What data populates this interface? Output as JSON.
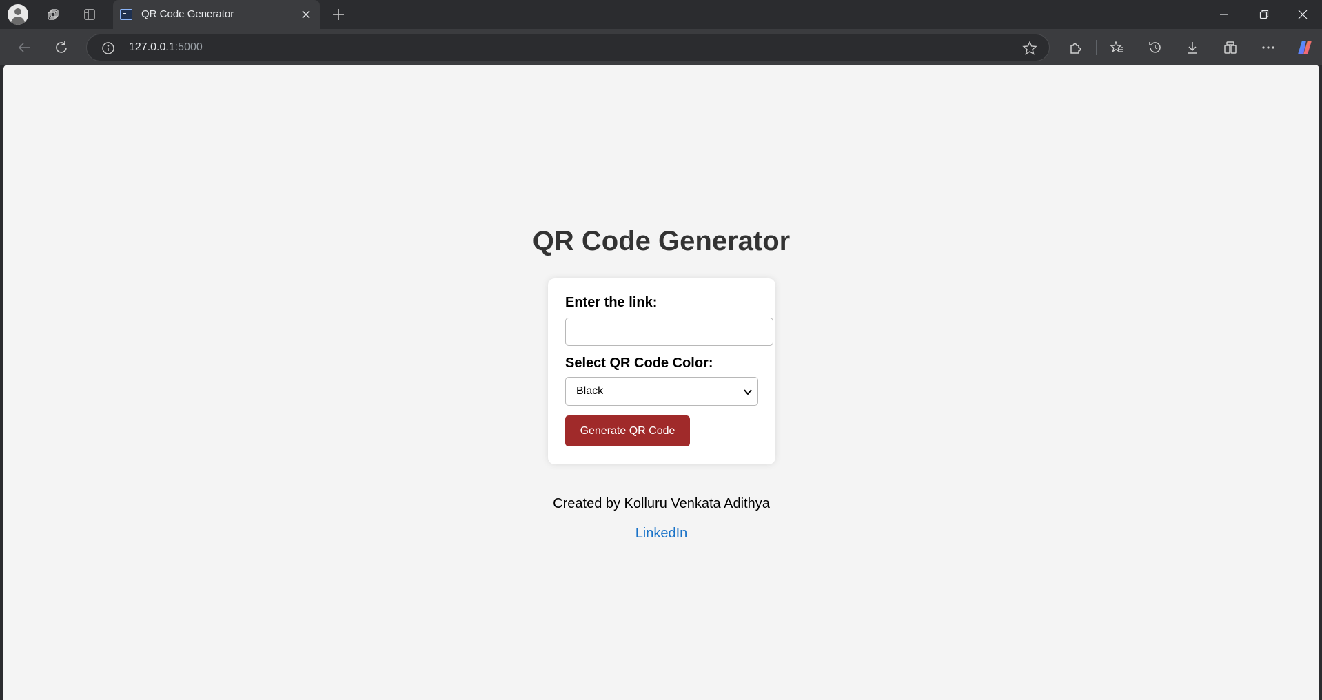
{
  "browser": {
    "tab_title": "QR Code Generator",
    "url_host": "127.0.0.1",
    "url_port": ":5000"
  },
  "page": {
    "title": "QR Code Generator",
    "form": {
      "link_label": "Enter the link:",
      "link_value": "",
      "color_label": "Select QR Code Color:",
      "color_selected": "Black",
      "submit_label": "Generate QR Code"
    },
    "footer": {
      "credit": "Created by Kolluru Venkata Adithya",
      "link_text": "LinkedIn"
    }
  },
  "colors": {
    "button": "#a02a2a",
    "link": "#1a73c8",
    "background": "#f4f4f4"
  },
  "icons": [
    "profile-icon",
    "workspaces-icon",
    "vertical-tabs-icon",
    "page-favicon",
    "close-icon",
    "plus-icon",
    "minimize-icon",
    "restore-icon",
    "back-icon",
    "reload-icon",
    "info-icon",
    "star-icon",
    "extensions-icon",
    "favorites-icon",
    "history-icon",
    "download-icon",
    "collections-icon",
    "more-icon",
    "copilot-icon",
    "chevron-down-icon"
  ]
}
